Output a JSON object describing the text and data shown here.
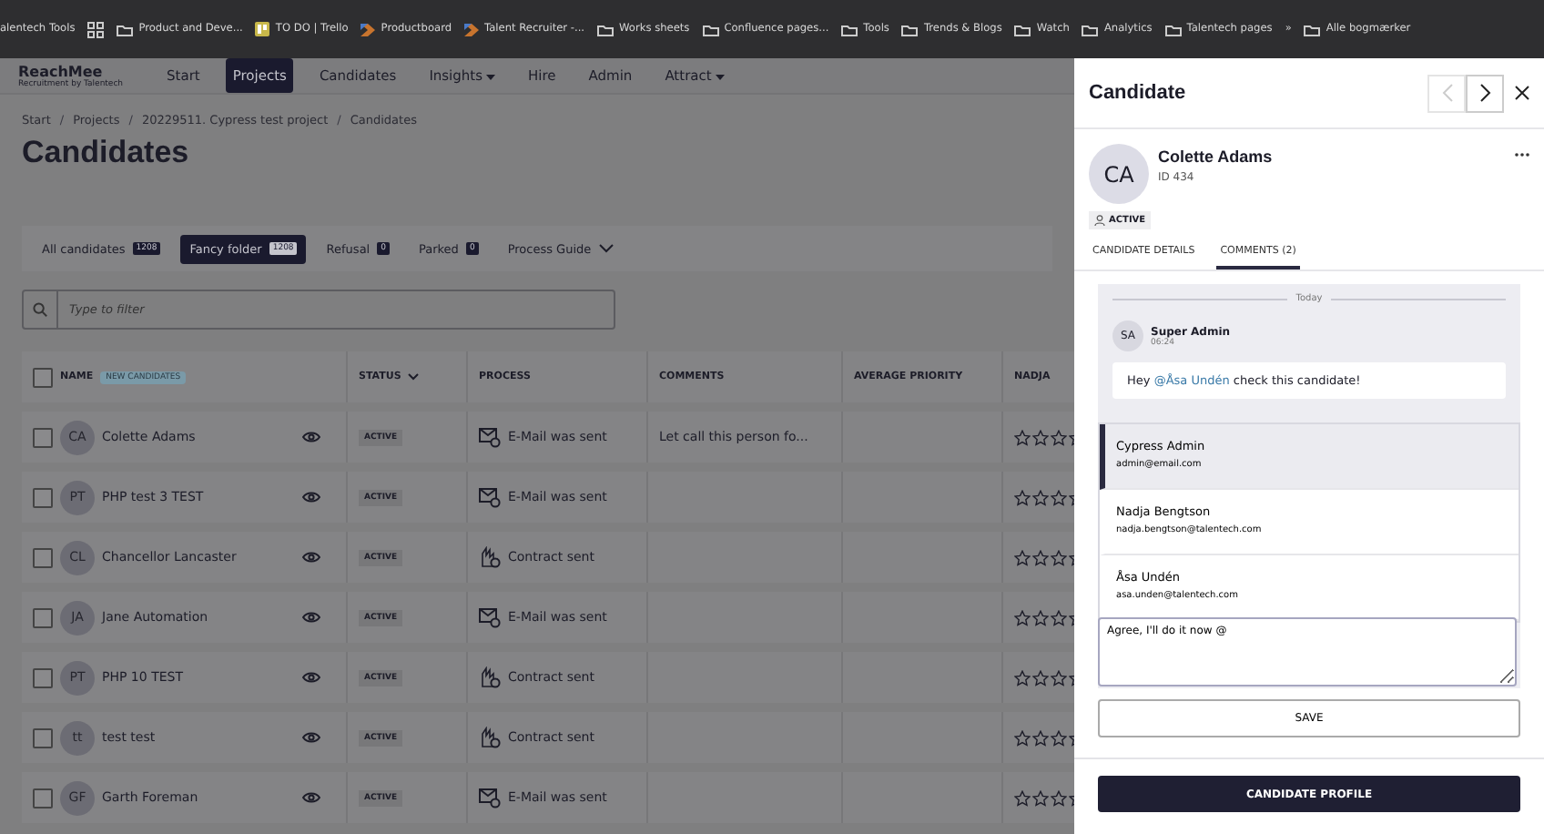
{
  "bookmarks_bar": {
    "items": [
      {
        "label": "alentech Tools",
        "kind": "text"
      },
      {
        "kind": "apps"
      },
      {
        "label": "Product and Deve...",
        "kind": "folder"
      },
      {
        "label": "TO DO | Trello",
        "kind": "trello"
      },
      {
        "label": "Productboard",
        "kind": "productboard"
      },
      {
        "label": "Talent Recruiter -...",
        "kind": "productboard"
      },
      {
        "label": "Works sheets",
        "kind": "folder"
      },
      {
        "label": "Confluence pages...",
        "kind": "folder"
      },
      {
        "label": "Tools",
        "kind": "folder"
      },
      {
        "label": "Trends & Blogs",
        "kind": "folder"
      },
      {
        "label": "Watch",
        "kind": "folder"
      },
      {
        "label": "Analytics",
        "kind": "folder"
      },
      {
        "label": "Talentech pages",
        "kind": "folder"
      },
      {
        "label": "»",
        "kind": "text"
      },
      {
        "label": "Alle bogmærker",
        "kind": "folder"
      }
    ]
  },
  "nav": {
    "logo": {
      "name": "ReachMee",
      "tagline": "Recruitment by Talentech"
    },
    "items": [
      {
        "label": "Start",
        "selected": false,
        "dropdown": false
      },
      {
        "label": "Projects",
        "selected": true,
        "dropdown": false
      },
      {
        "label": "Candidates",
        "selected": false,
        "dropdown": false
      },
      {
        "label": "Insights",
        "selected": false,
        "dropdown": true
      },
      {
        "label": "Hire",
        "selected": false,
        "dropdown": false
      },
      {
        "label": "Admin",
        "selected": false,
        "dropdown": false
      },
      {
        "label": "Attract",
        "selected": false,
        "dropdown": true
      }
    ]
  },
  "breadcrumbs": [
    {
      "kind": "link",
      "label": "Start"
    },
    {
      "kind": "separator",
      "label": "/"
    },
    {
      "kind": "link",
      "label": "Projects"
    },
    {
      "kind": "separator",
      "label": "/"
    },
    {
      "kind": "link",
      "label": "20229511. Cypress test project"
    },
    {
      "kind": "separator",
      "label": "/"
    },
    {
      "kind": "link",
      "label": "Candidates"
    }
  ],
  "page_title": "Candidates",
  "folder_tabs": [
    {
      "label": "All candidates",
      "count": "1208",
      "selected": false
    },
    {
      "label": "Fancy folder",
      "count": "1208",
      "selected": true
    },
    {
      "label": "Refusal",
      "count": "0",
      "selected": false
    },
    {
      "label": "Parked",
      "count": "0",
      "selected": false
    }
  ],
  "process_guide": "Process Guide",
  "filter": {
    "placeholder": "Type to filter"
  },
  "table": {
    "select_all_checked": false,
    "columns": [
      {
        "label": "NAME",
        "badge": "NEW CANDIDATES",
        "sortable": false
      },
      {
        "label": "STATUS",
        "sortable": true
      },
      {
        "label": "PROCESS",
        "sortable": false
      },
      {
        "label": "COMMENTS",
        "sortable": false
      },
      {
        "label": "AVERAGE PRIORITY",
        "sortable": false
      },
      {
        "label": "NADJA",
        "sortable": false
      }
    ],
    "rows": [
      {
        "initials": "CA",
        "name": "Colette Adams",
        "status": "ACTIVE",
        "process": "E-Mail was sent",
        "kind": "email",
        "comment": "Let call this person fo...",
        "stars": 0,
        "checked": false
      },
      {
        "initials": "PT",
        "name": "PHP test 3 TEST",
        "status": "ACTIVE",
        "process": "E-Mail was sent",
        "kind": "email",
        "stars": 0,
        "checked": false
      },
      {
        "initials": "CL",
        "name": "Chancellor Lancaster",
        "status": "ACTIVE",
        "process": "Contract sent",
        "kind": "contract",
        "stars": 0,
        "checked": false
      },
      {
        "initials": "JA",
        "name": "Jane Automation",
        "status": "ACTIVE",
        "process": "E-Mail was sent",
        "kind": "email",
        "stars": 0,
        "checked": false
      },
      {
        "initials": "PT",
        "name": "PHP 10 TEST",
        "status": "ACTIVE",
        "process": "Contract sent",
        "kind": "contract",
        "stars": 0,
        "checked": false
      },
      {
        "initials": "tt",
        "name": "test test",
        "status": "ACTIVE",
        "process": "Contract sent",
        "kind": "contract",
        "stars": 0,
        "checked": false
      },
      {
        "initials": "GF",
        "name": "Garth Foreman",
        "status": "ACTIVE",
        "process": "E-Mail was sent",
        "kind": "email",
        "stars": 0,
        "checked": false
      }
    ]
  },
  "panel": {
    "title": "Candidate",
    "prev_disabled": true,
    "next_disabled": false,
    "candidate": {
      "initials": "CA",
      "name": "Colette Adams",
      "id": "ID 434",
      "status": "ACTIVE"
    },
    "tabs": [
      {
        "label": "CANDIDATE DETAILS",
        "selected": false
      },
      {
        "label": "COMMENTS (2)",
        "selected": true
      }
    ],
    "day": "Today",
    "comment": {
      "initials": "SA",
      "author": "Super Admin",
      "time": "06:24",
      "text_before": "Hey ",
      "mention": "@Åsa Undén",
      "text_after": " check this candidate!"
    },
    "mention_options": [
      {
        "name": "Cypress Admin",
        "email": "admin@email.com",
        "selected": true
      },
      {
        "name": "Nadja Bengtson",
        "email": "nadja.bengtson@talentech.com",
        "selected": false
      },
      {
        "name": "Åsa Undén",
        "email": "asa.unden@talentech.com",
        "selected": false
      }
    ],
    "comment_input": {
      "value": "Agree, I'll do it now @"
    },
    "save_button": "SAVE",
    "profile_button": "CANDIDATE PROFILE"
  }
}
